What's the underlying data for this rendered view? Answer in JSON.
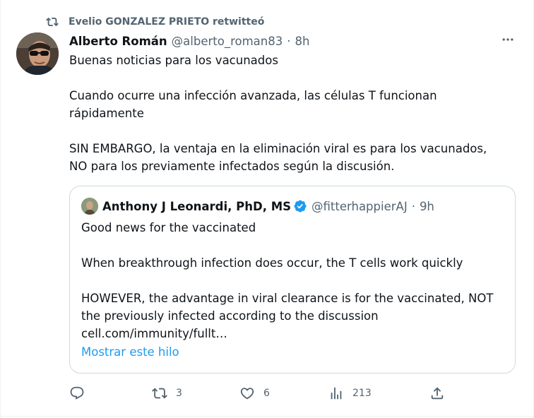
{
  "retweet": {
    "icon": "retweet-icon",
    "text": "Evelio GONZALEZ PRIETO retwitteó"
  },
  "author": {
    "display_name": "Alberto Román",
    "handle": "@alberto_roman83",
    "separator": "·",
    "time": "8h"
  },
  "tweet_text": [
    "Buenas noticias para los vacunados",
    "Cuando ocurre una infección avanzada, las células T funcionan\nrápidamente",
    "SIN EMBARGO, la ventaja en la eliminación viral es para los vacunados,\nNO para los previamente infectados según la discusión."
  ],
  "quoted": {
    "display_name": "Anthony J Leonardi, PhD, MS",
    "verified": true,
    "handle": "@fitterhappierAJ",
    "separator": "·",
    "time": "9h",
    "text": [
      "Good news for the vaccinated",
      "When breakthrough infection does occur, the T cells work quickly",
      "HOWEVER, the advantage in viral clearance is for the vaccinated, NOT\nthe previously infected according to the discussion\ncell.com/immunity/fullt…"
    ],
    "show_thread": "Mostrar este hilo"
  },
  "actions": {
    "reply": {
      "icon": "reply-icon",
      "count": ""
    },
    "retweet": {
      "icon": "retweet-icon",
      "count": "3"
    },
    "like": {
      "icon": "heart-icon",
      "count": "6"
    },
    "views": {
      "icon": "views-icon",
      "count": "213"
    },
    "share": {
      "icon": "share-icon",
      "count": ""
    }
  },
  "colors": {
    "text_primary": "#0f1419",
    "text_secondary": "#536471",
    "link": "#1d9bf0",
    "border": "#cfd9de",
    "verified": "#1d9bf0"
  }
}
